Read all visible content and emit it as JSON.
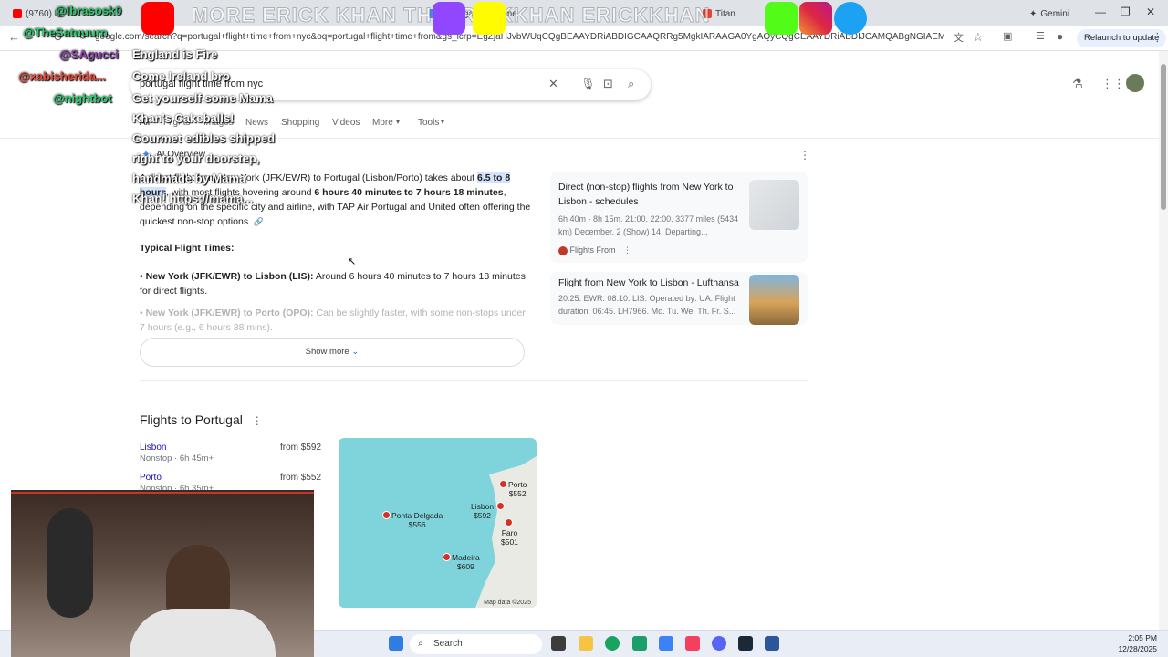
{
  "browser": {
    "tabs": [
      {
        "label": "(9760) H",
        "color": "#ff0000"
      },
      {
        "label": "@Ibrasosk0",
        "color": "#5f6368"
      },
      {
        "label": "Portugal flight time",
        "color": "#4285f4"
      },
      {
        "label": "Titan",
        "color": "#ea4335"
      },
      {
        "label": "Gemini",
        "color": "#8e44ad"
      }
    ],
    "url": "google.com/search?q=portugal+flight+time+from+nyc&oq=portugal+flight+time+from&gs_lcrp=EgZjaHJvbWUqCQgBEAAYDRiABDIGCAAQRRg5MgkIARAAGA0YgAQyCQgCEAAYDRiABDIJCAMQABgNGIAEMgkIBBAAGA0Y...",
    "relaunch_label": "Relaunch to update"
  },
  "search": {
    "query": "portugal flight time from nyc",
    "tabs": [
      "All",
      "Flights",
      "Images",
      "News",
      "Shopping",
      "Videos",
      "More",
      "Tools"
    ]
  },
  "ai_overview": {
    "title": "AI Overview",
    "para_pre": "A direct flight from New York (JFK/EWR) to Portugal (Lisbon/Porto) takes about ",
    "para_highlight": "6.5 to 8 hours",
    "para_mid": ", with most flights hovering around ",
    "para_bold": "6 hours 40 minutes to 7 hours 18 minutes",
    "para_post": ", depending on the specific city and airline, with TAP Air Portugal and United often offering the quickest non-stop options.",
    "heading": "Typical Flight Times:",
    "bullet1_bold": "New York (JFK/EWR) to Lisbon (LIS):",
    "bullet1_text": " Around 6 hours 40 minutes to 7 hours 18 minutes for direct flights.",
    "bullet2_bold": "New York (JFK/EWR) to Porto (OPO):",
    "bullet2_text": " Can be slightly faster, with some non-stops under 7 hours (e.g., 6 hours 38 mins).",
    "show_more": "Show more",
    "cards": [
      {
        "title": "Direct (non-stop) flights from New York to Lisbon - schedules",
        "sub": "6h 40m - 8h 15m. 21:00. 22:00. 3377 miles (5434 km) December. 2 (Show) 14. Departing...",
        "source": "Flights From"
      },
      {
        "title": "Flight from New York to Lisbon - Lufthansa",
        "sub": "20:25. EWR. 08:10. LIS. Operated by: UA. Flight duration: 06:45. LH7966. Mo. Tu. We. Th. Fr. S..."
      }
    ]
  },
  "flights": {
    "title": "Flights to Portugal",
    "rows": [
      {
        "city": "Lisbon",
        "sub": "Nonstop · 6h 45m+",
        "price": "from $592"
      },
      {
        "city": "Porto",
        "sub": "Nonstop · 6h 35m+",
        "price": "from $552"
      }
    ],
    "map_labels": [
      {
        "name": "Porto",
        "price": "$552"
      },
      {
        "name": "Lisbon",
        "price": "$592"
      },
      {
        "name": "Faro",
        "price": "$501"
      },
      {
        "name": "Ponta Delgada",
        "price": "$556"
      },
      {
        "name": "Madeira",
        "price": "$609"
      }
    ],
    "map_data": "Map data ©2025"
  },
  "taskbar": {
    "search": "Search",
    "time": "2:05 PM",
    "date": "12/28/2025"
  },
  "overlay": {
    "banner": "MORE ERICK KHAN    THEERICKKHAN    ERICKKHAN",
    "chat": [
      {
        "text": "@Ibrasosk0",
        "color": "#2ecc71"
      },
      {
        "text": "@TheSatuuurn",
        "color": "#2ecc71"
      },
      {
        "text": "@SAgucci",
        "color": "#8e44ad"
      },
      {
        "text": "England is Fire",
        "color": "#ffffff"
      },
      {
        "text": "Come Ireland bro",
        "color": "#ffffff"
      },
      {
        "text": "@xabisherida...",
        "color": "#e74c3c"
      },
      {
        "text": "@nightbot",
        "color": "#2ecc71"
      },
      {
        "text": "Get yourself some Mama",
        "color": "#ffffff"
      },
      {
        "text": "Khan's Cakeballs!",
        "color": "#ffffff"
      },
      {
        "text": "Gourmet edibles shipped",
        "color": "#ffffff"
      },
      {
        "text": "right to your doorstep,",
        "color": "#ffffff"
      },
      {
        "text": "handmade by Mama",
        "color": "#ffffff"
      },
      {
        "text": "Khan! https://mama...",
        "color": "#ffffff"
      }
    ]
  }
}
